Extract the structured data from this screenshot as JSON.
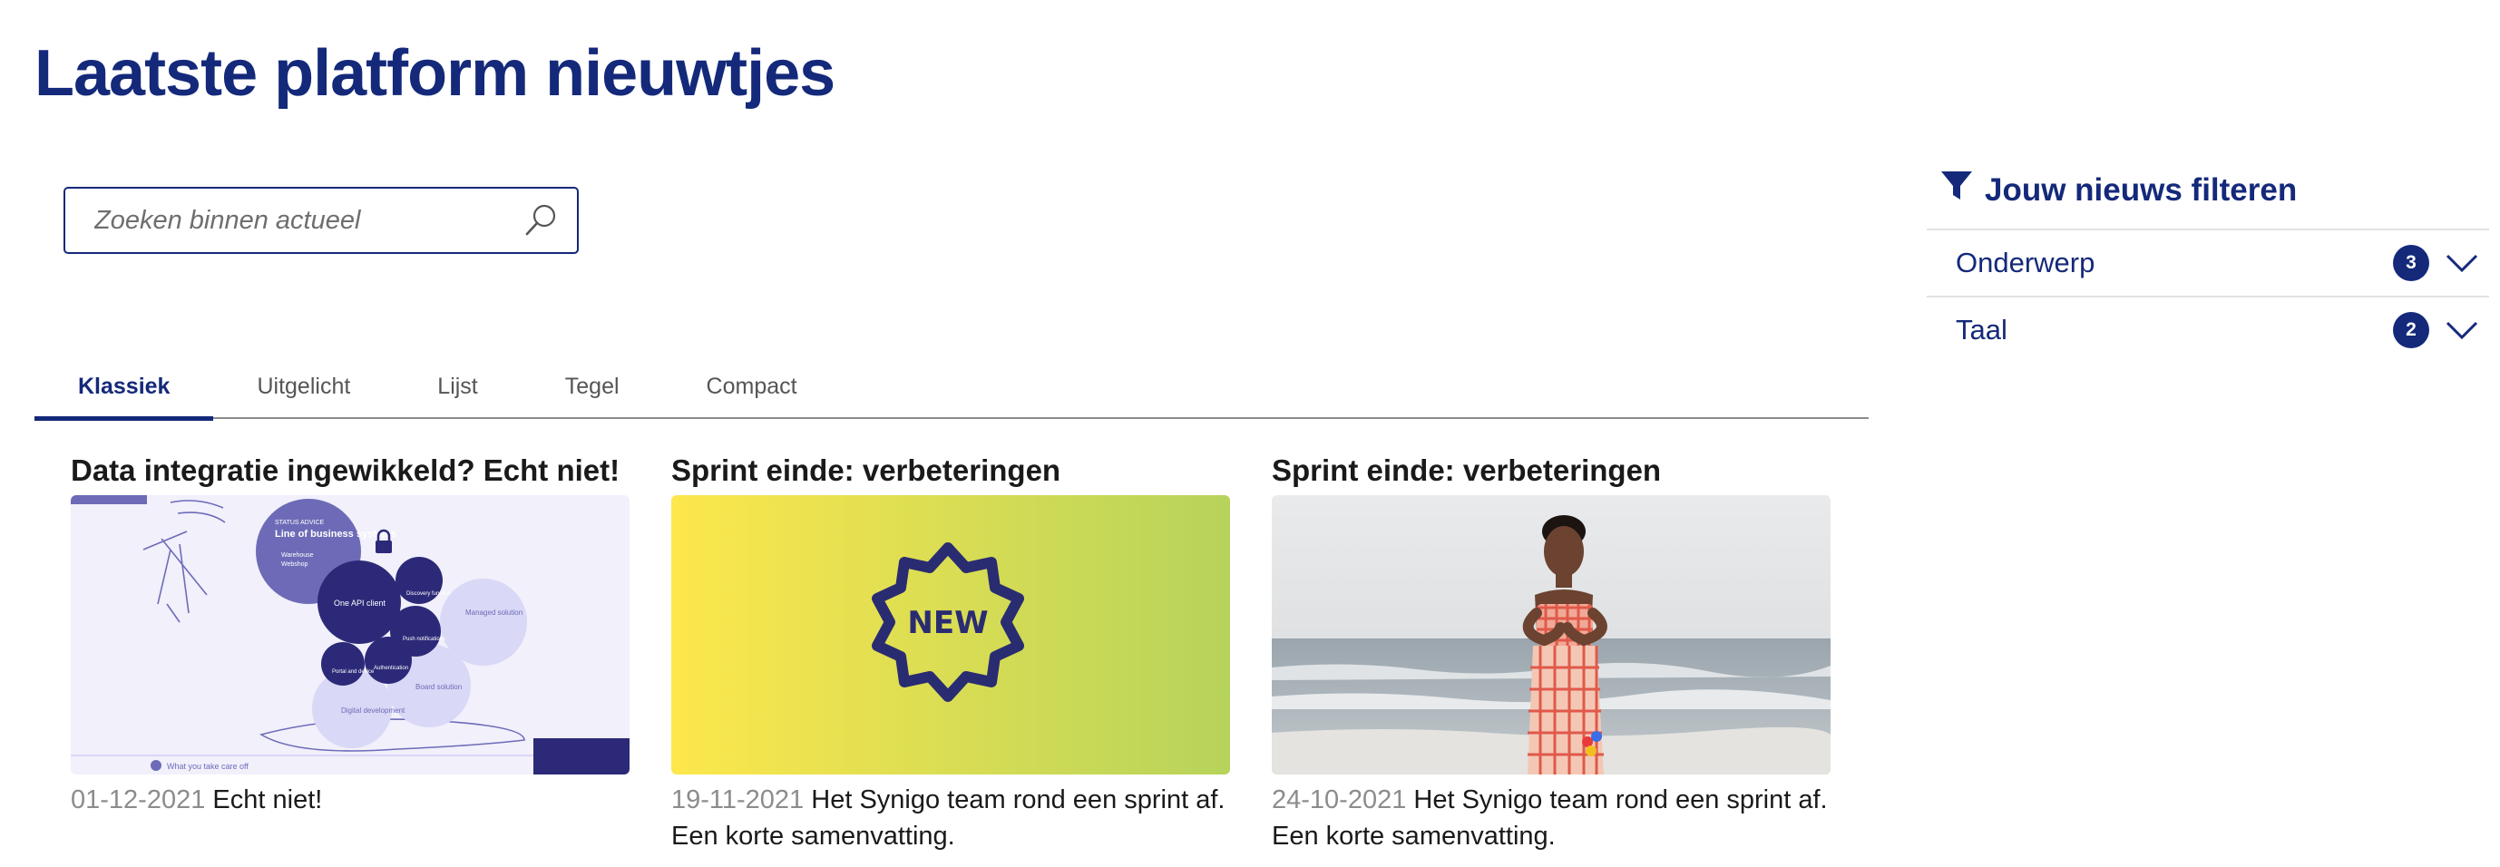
{
  "page": {
    "title": "Laatste platform nieuwtjes"
  },
  "search": {
    "placeholder": "Zoeken binnen actueel",
    "value": ""
  },
  "tabs": [
    {
      "label": "Klassiek",
      "active": true
    },
    {
      "label": "Uitgelicht",
      "active": false
    },
    {
      "label": "Lijst",
      "active": false
    },
    {
      "label": "Tegel",
      "active": false
    },
    {
      "label": "Compact",
      "active": false
    }
  ],
  "articles": [
    {
      "title": "Data integratie ingewikkeld? Echt niet!",
      "date": "01-12-2021",
      "summary": "Echt niet!",
      "image": "api-diagram-illustration"
    },
    {
      "title": "Sprint einde: verbeteringen",
      "date": "19-11-2021",
      "summary": "Het Synigo team rond een sprint af. Een korte samenvatting.",
      "image": "new-badge-gradient"
    },
    {
      "title": "Sprint einde: verbeteringen",
      "date": "24-10-2021",
      "summary": "Het Synigo team rond een sprint af. Een korte samenvatting.",
      "image": "woman-at-beach-photo"
    }
  ],
  "illustration": {
    "bubble_main": "Line of business systems",
    "bubble_tag": "STATUS ADVICE",
    "bubble_sub1": "Warehouse",
    "bubble_sub2": "Webshop",
    "center": "One API client",
    "discovery": "Discovery function",
    "push": "Push notifications",
    "auth": "Authentication",
    "portal": "Portal and device",
    "managed": "Managed solution",
    "digital": "Digital development",
    "board": "Board solution",
    "footer": "What you take care off"
  },
  "new_badge": {
    "text": "NEW"
  },
  "filters": {
    "heading": "Jouw nieuws filteren",
    "items": [
      {
        "label": "Onderwerp",
        "count": "3"
      },
      {
        "label": "Taal",
        "count": "2"
      }
    ]
  },
  "colors": {
    "primary": "#14297a",
    "muted_date": "#8c8c8c",
    "gradient_start": "#fde74c",
    "gradient_end": "#b6d35b"
  }
}
